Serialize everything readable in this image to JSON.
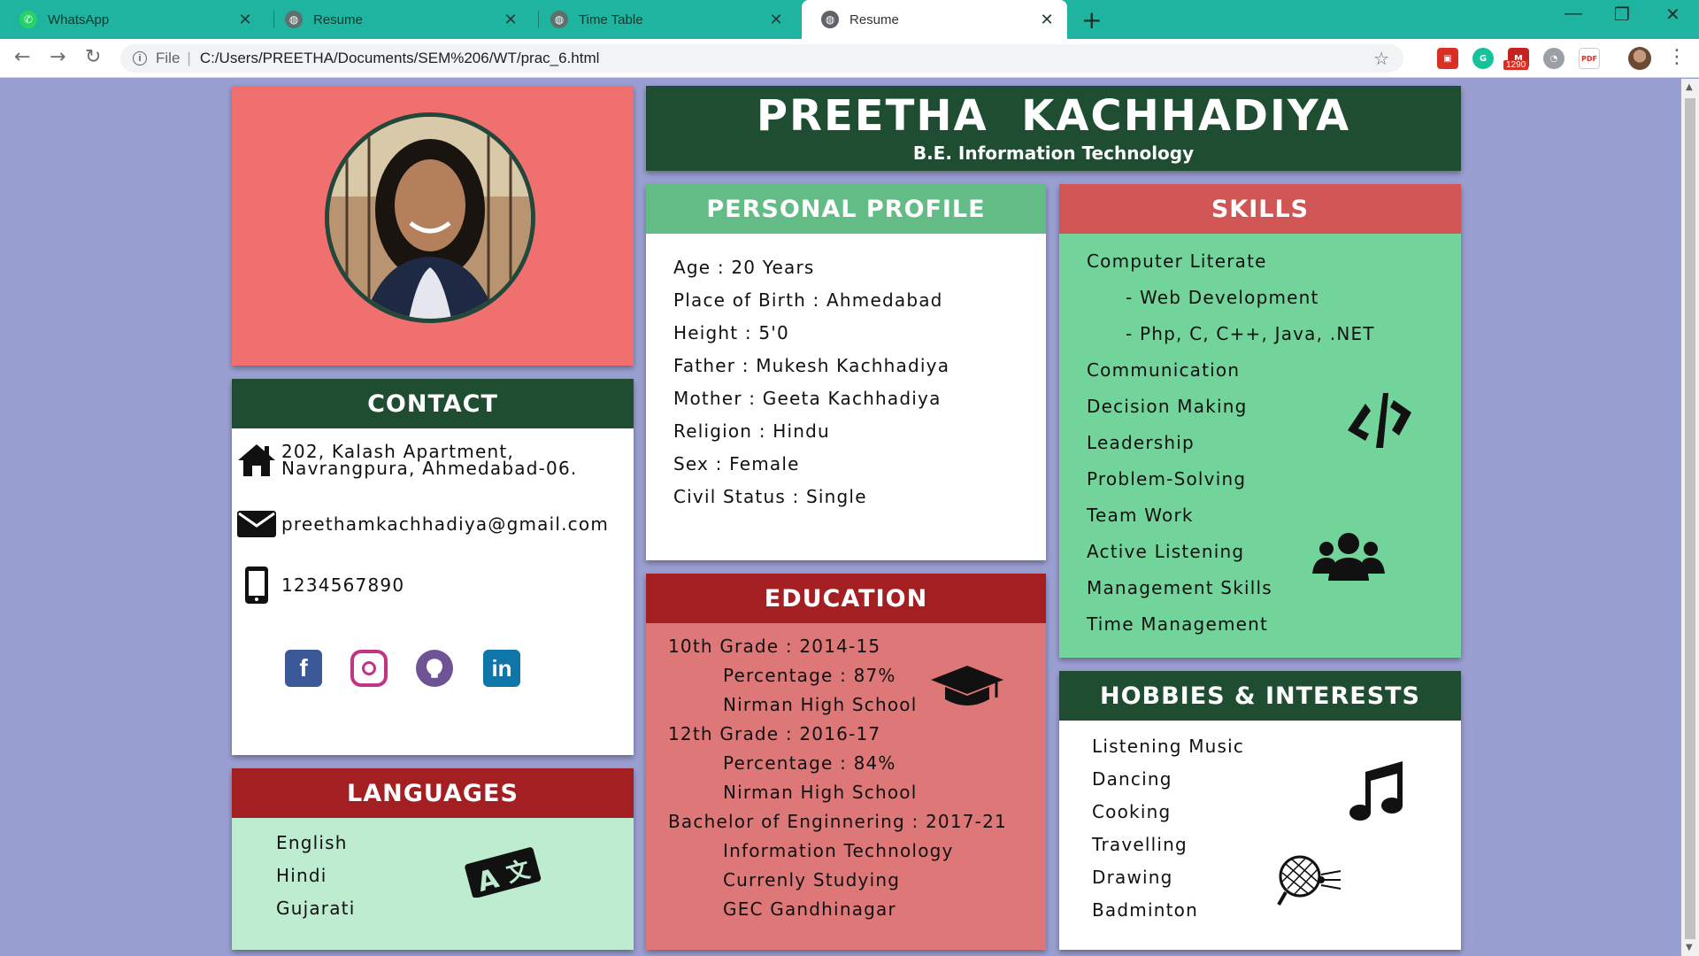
{
  "browser": {
    "tabs": [
      {
        "title": "WhatsApp",
        "icon": "whatsapp-icon",
        "active": false
      },
      {
        "title": "Resume",
        "icon": "globe-icon",
        "active": false
      },
      {
        "title": "Time Table",
        "icon": "globe-icon",
        "active": false
      },
      {
        "title": "Resume",
        "icon": "globe-icon",
        "active": true
      }
    ],
    "address_prefix": "File",
    "url": "C:/Users/PREETHA/Documents/SEM%206/WT/prac_6.html",
    "extension_badge": "1290",
    "extension_label_pdf": "PDF"
  },
  "resume": {
    "name": "PREETHA  KACHHADIYA",
    "degree": "B.E. Information Technology",
    "contact": {
      "heading": "CONTACT",
      "address_line1": "202, Kalash Apartment,",
      "address_line2": "Navrangpura, Ahmedabad-06.",
      "email": "preethamkachhadiya@gmail.com",
      "phone": "1234567890",
      "social": [
        "facebook",
        "instagram",
        "github",
        "linkedin"
      ],
      "social_colors": {
        "facebook": "#3b5998",
        "instagram": "#c13584",
        "github": "#6e5494",
        "linkedin": "#0e76a8"
      }
    },
    "languages": {
      "heading": "LANGUAGES",
      "items": [
        "English",
        "Hindi",
        "Gujarati"
      ]
    },
    "personal_profile": {
      "heading": "PERSONAL PROFILE",
      "items": [
        "Age : 20 Years",
        "Place of Birth : Ahmedabad",
        "Height : 5'0",
        "Father : Mukesh Kachhadiya",
        "Mother : Geeta Kachhadiya",
        "Religion : Hindu",
        "Sex : Female",
        "Civil Status : Single"
      ]
    },
    "education": {
      "heading": "EDUCATION",
      "lines": [
        {
          "text": "10th Grade : 2014-15",
          "indent": false
        },
        {
          "text": "Percentage : 87%",
          "indent": true
        },
        {
          "text": "Nirman High School",
          "indent": true
        },
        {
          "text": "12th Grade : 2016-17",
          "indent": false
        },
        {
          "text": "Percentage : 84%",
          "indent": true
        },
        {
          "text": "Nirman High School",
          "indent": true
        },
        {
          "text": "Bachelor of Enginnering : 2017-21",
          "indent": false
        },
        {
          "text": "Information Technology",
          "indent": true
        },
        {
          "text": "Currenly Studying",
          "indent": true
        },
        {
          "text": "GEC Gandhinagar",
          "indent": true
        }
      ]
    },
    "skills": {
      "heading": "SKILLS",
      "lines": [
        {
          "text": "Computer Literate",
          "indent": false
        },
        {
          "text": "- Web Development",
          "indent": true
        },
        {
          "text": "- Php, C, C++, Java, .NET",
          "indent": true
        },
        {
          "text": "Communication",
          "indent": false
        },
        {
          "text": "Decision Making",
          "indent": false
        },
        {
          "text": "Leadership",
          "indent": false
        },
        {
          "text": "Problem-Solving",
          "indent": false
        },
        {
          "text": "Team Work",
          "indent": false
        },
        {
          "text": "Active Listening",
          "indent": false
        },
        {
          "text": "Management Skills",
          "indent": false
        },
        {
          "text": "Time Management",
          "indent": false
        }
      ]
    },
    "hobbies": {
      "heading": "HOBBIES & INTERESTS",
      "items": [
        "Listening Music",
        "Dancing",
        "Cooking",
        "Travelling",
        "Drawing",
        "Badminton"
      ]
    }
  }
}
